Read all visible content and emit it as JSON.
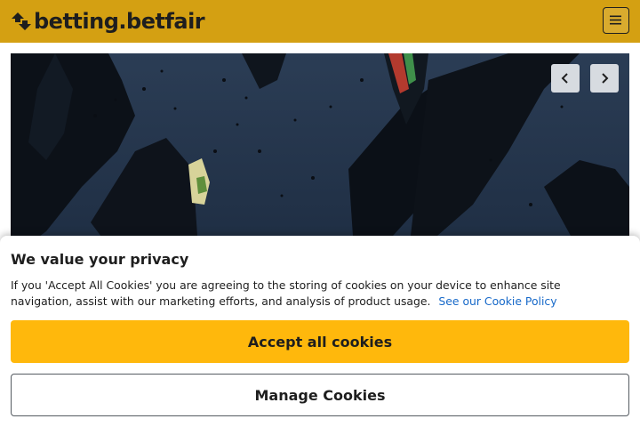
{
  "header": {
    "brand_logo": "betting.betfair",
    "logo_icon": "betfair-arrows-icon",
    "menu_icon": "hamburger-menu-icon",
    "background_color": "#d4a012"
  },
  "hero": {
    "prev_icon": "chevron-left-icon",
    "next_icon": "chevron-right-icon"
  },
  "cookie_banner": {
    "title": "We value your privacy",
    "body": "If you 'Accept All Cookies' you are agreeing to the storing of cookies on your device to enhance site navigation, assist with our marketing efforts, and analysis of product usage.",
    "policy_link": "See our Cookie Policy",
    "accept_label": "Accept all cookies",
    "manage_label": "Manage Cookies",
    "accept_color": "#ffb80c",
    "link_color": "#1769c9"
  }
}
